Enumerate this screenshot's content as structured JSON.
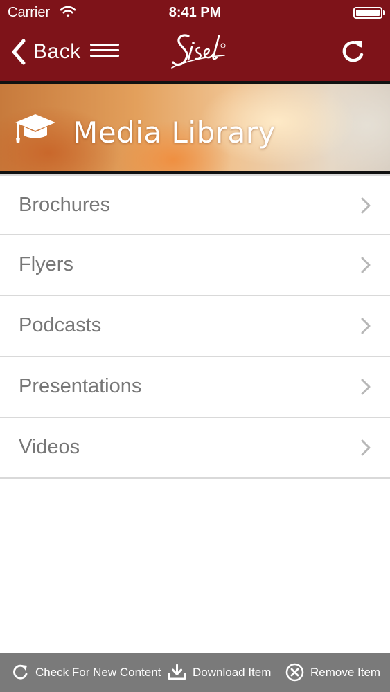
{
  "status_bar": {
    "carrier": "Carrier",
    "time": "8:41 PM",
    "wifi_icon": "wifi-icon",
    "battery_icon": "battery-icon"
  },
  "nav_bar": {
    "back_label": "Back",
    "back_icon": "chevron-left-icon",
    "menu_icon": "hamburger-icon",
    "logo_text": "Sisel",
    "refresh_icon": "refresh-icon",
    "background_color": "#7e1319"
  },
  "banner": {
    "title": "Media Library",
    "icon": "graduation-cap-icon"
  },
  "menu": {
    "items": [
      {
        "label": "Brochures"
      },
      {
        "label": "Flyers"
      },
      {
        "label": "Podcasts"
      },
      {
        "label": "Presentations"
      },
      {
        "label": "Videos"
      }
    ],
    "chevron_icon": "chevron-right-icon"
  },
  "toolbar": {
    "check_label": "Check For New Content",
    "download_label": "Download Item",
    "remove_label": "Remove Item",
    "background_color": "#7a7a7a"
  }
}
